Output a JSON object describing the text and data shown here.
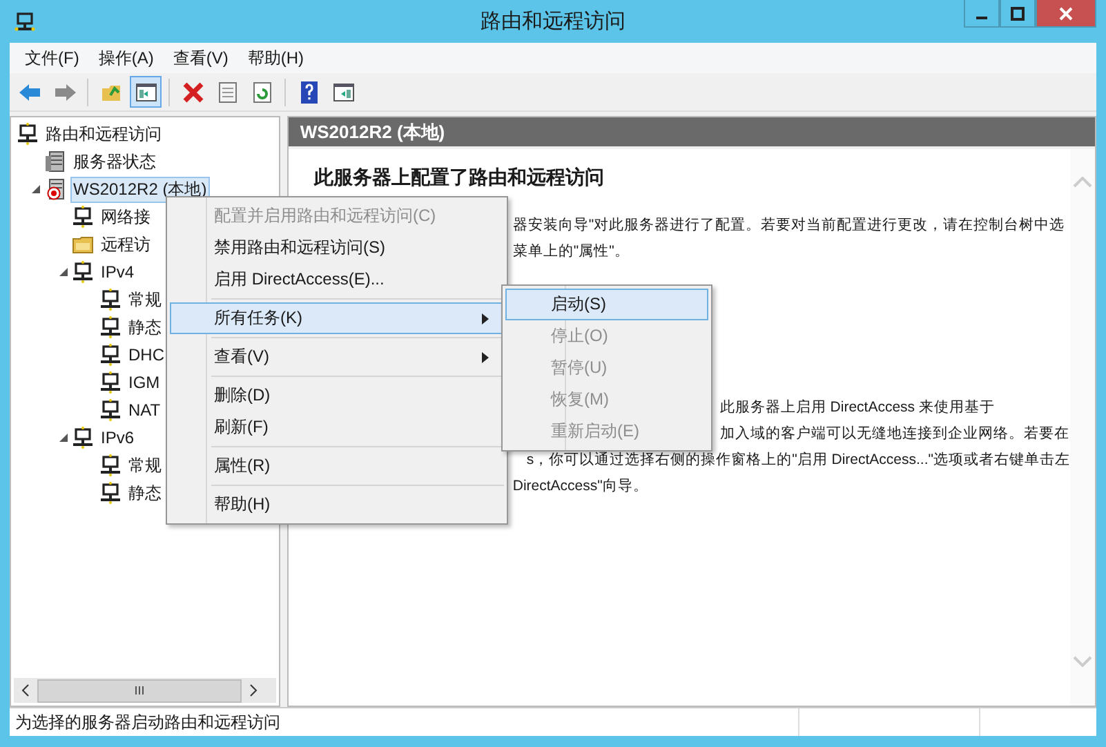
{
  "window": {
    "title": "路由和远程访问"
  },
  "menu_bar": [
    "文件(F)",
    "操作(A)",
    "查看(V)",
    "帮助(H)"
  ],
  "toolbar": [
    {
      "kind": "back",
      "disabled": false,
      "selected": false
    },
    {
      "kind": "forward",
      "disabled": true,
      "selected": false
    },
    {
      "kind": "separator"
    },
    {
      "kind": "up",
      "selected": false
    },
    {
      "kind": "tree-pane",
      "selected": true
    },
    {
      "kind": "separator"
    },
    {
      "kind": "delete",
      "selected": false
    },
    {
      "kind": "properties",
      "selected": false
    },
    {
      "kind": "refresh",
      "selected": false
    },
    {
      "kind": "separator"
    },
    {
      "kind": "help",
      "selected": false
    },
    {
      "kind": "action-pane",
      "selected": false
    }
  ],
  "tree": [
    {
      "label": "路由和远程访问",
      "kind": "network",
      "selected": false,
      "children": [
        {
          "label": "服务器状态",
          "kind": "server",
          "selected": false
        },
        {
          "label": "WS2012R2 (本地)",
          "kind": "server-error",
          "selected": true,
          "expanded": true,
          "children": [
            {
              "label": "网络接",
              "kind": "network",
              "selected": false
            },
            {
              "label": "远程访",
              "kind": "folder",
              "selected": false
            },
            {
              "label": "IPv4",
              "kind": "network",
              "selected": false,
              "expanded": true,
              "children": [
                {
                  "label": "常规",
                  "kind": "network",
                  "selected": false
                },
                {
                  "label": "静态",
                  "kind": "network",
                  "selected": false
                },
                {
                  "label": "DHC",
                  "kind": "network",
                  "selected": false
                },
                {
                  "label": "IGM",
                  "kind": "network",
                  "selected": false
                },
                {
                  "label": "NAT",
                  "kind": "network",
                  "selected": false
                }
              ]
            },
            {
              "label": "IPv6",
              "kind": "network",
              "selected": false,
              "expanded": true,
              "children": [
                {
                  "label": "常规",
                  "kind": "network",
                  "selected": false
                },
                {
                  "label": "静态",
                  "kind": "network",
                  "selected": false
                }
              ]
            }
          ]
        }
      ]
    }
  ],
  "content": {
    "header": "WS2012R2 (本地)",
    "heading": "此服务器上配置了路由和远程访问",
    "paragraphs": [
      [
        "器安装向导\"对此服务器进行了配置。若要对当前配置进行更改，请在控制台树中选",
        "菜单上的\"属性\"。"
      ],
      [
        "此服务器上启用 DirectAccess 来使用基于",
        "加入域的客户端可以无缝地连接到企业网络。若要在",
        "s，你可以通过选择右侧的操作窗格上的\"启用 DirectAccess...\"选项或者右键单击左",
        "DirectAccess\"向导。"
      ]
    ]
  },
  "context_menu": [
    {
      "kind": "item",
      "label": "配置并启用路由和远程访问(C)",
      "disabled": true,
      "selected": false,
      "submenu": false
    },
    {
      "kind": "item",
      "label": "禁用路由和远程访问(S)",
      "disabled": false,
      "selected": false,
      "submenu": false
    },
    {
      "kind": "item",
      "label": "启用 DirectAccess(E)...",
      "disabled": false,
      "selected": false,
      "submenu": false
    },
    {
      "kind": "separator"
    },
    {
      "kind": "item",
      "label": "所有任务(K)",
      "disabled": false,
      "selected": true,
      "submenu": true
    },
    {
      "kind": "separator"
    },
    {
      "kind": "item",
      "label": "查看(V)",
      "disabled": false,
      "selected": false,
      "submenu": true
    },
    {
      "kind": "separator"
    },
    {
      "kind": "item",
      "label": "删除(D)",
      "disabled": false,
      "selected": false,
      "submenu": false
    },
    {
      "kind": "item",
      "label": "刷新(F)",
      "disabled": false,
      "selected": false,
      "submenu": false
    },
    {
      "kind": "separator"
    },
    {
      "kind": "item",
      "label": "属性(R)",
      "disabled": false,
      "selected": false,
      "submenu": false
    },
    {
      "kind": "separator"
    },
    {
      "kind": "item",
      "label": "帮助(H)",
      "disabled": false,
      "selected": false,
      "submenu": false
    }
  ],
  "submenu": [
    {
      "label": "启动(S)",
      "disabled": false,
      "selected": true
    },
    {
      "label": "停止(O)",
      "disabled": true,
      "selected": false
    },
    {
      "label": "暂停(U)",
      "disabled": true,
      "selected": false
    },
    {
      "label": "恢复(M)",
      "disabled": true,
      "selected": false
    },
    {
      "label": "重新启动(E)",
      "disabled": true,
      "selected": false
    }
  ],
  "status_bar": {
    "text": "为选择的服务器启动路由和远程访问"
  }
}
